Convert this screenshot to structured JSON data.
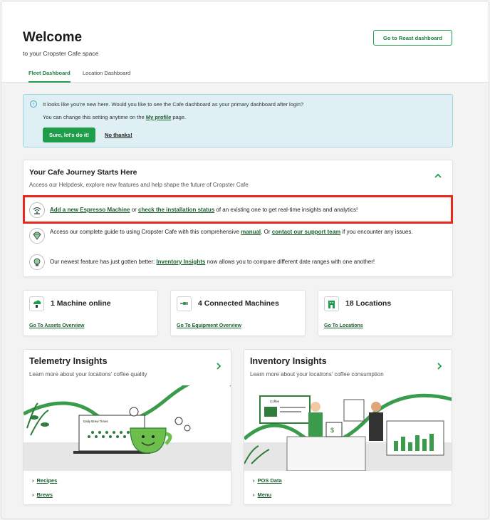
{
  "header": {
    "title": "Welcome",
    "subtitle": "to your Cropster Cafe space",
    "roast_button": "Go to Roast dashboard",
    "tabs": [
      {
        "label": "Fleet Dashboard",
        "active": true
      },
      {
        "label": "Location Dashboard",
        "active": false
      }
    ]
  },
  "info_banner": {
    "line1": "It looks like you're new here. Would you like to see the Cafe dashboard as your primary dashboard after login?",
    "line2_pre": "You can change this setting anytime on the ",
    "line2_link": "My profile",
    "line2_post": " page.",
    "yes_button": "Sure, let's do it!",
    "no_link": "No thanks!",
    "icon": "info-icon"
  },
  "journey": {
    "title": "Your Cafe Journey Starts Here",
    "subtitle": "Access our Helpdesk, explore new features and help shape the future of Cropster Cafe",
    "row1": {
      "link1": "Add a new Espresso Machine",
      "mid": " or ",
      "link2": "check the installation status",
      "post": " of an existing one to get real-time insights and analytics!",
      "icon": "wifi-machine-icon"
    },
    "row2": {
      "pre": "Access our complete guide to using Cropster Cafe with this comprehensive ",
      "link1": "manual",
      "mid": ". Or ",
      "link2": "contact our support team",
      "post": " if you encounter any issues.",
      "icon": "diamond-guide-icon"
    },
    "row3": {
      "pre": "Our newest feature has just gotten better: ",
      "link1": "Inventory Insights",
      "post": " now allows you to compare different date ranges with one another!",
      "icon": "lightbulb-icon"
    }
  },
  "stats": [
    {
      "label": "1 Machine online",
      "link": "Go To Assets Overview",
      "icon": "cloud-machine-icon"
    },
    {
      "label": "4 Connected Machines",
      "link": "Go To Equipment Overview",
      "icon": "connected-plug-icon"
    },
    {
      "label": "18 Locations",
      "link": "Go To Locations",
      "icon": "building-icon"
    }
  ],
  "insights": [
    {
      "title": "Telemetry Insights",
      "subtitle": "Learn more about your locations' coffee quality",
      "chart_caption": "Daily Brew Times",
      "links": [
        "Recipes",
        "Brews"
      ]
    },
    {
      "title": "Inventory Insights",
      "subtitle": "Learn more about your locations' coffee consumption",
      "menu_caption": "Coffee",
      "links": [
        "POS Data",
        "Menu"
      ]
    }
  ],
  "colors": {
    "accent": "#1f9d4a",
    "accent_dark": "#1a7f3c",
    "highlight": "#e8281e",
    "info_bg": "#dff0f4"
  }
}
